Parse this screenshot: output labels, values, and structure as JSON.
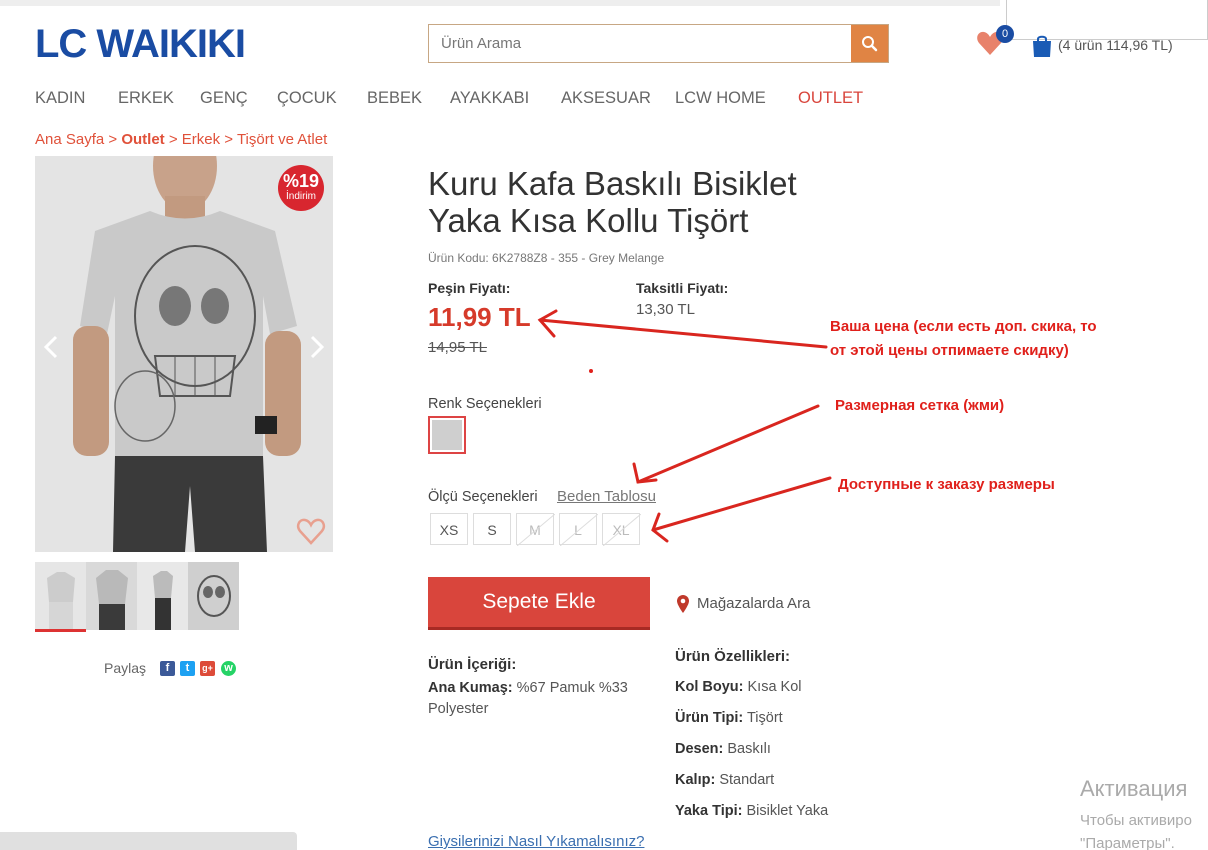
{
  "header": {
    "logo_text": "LC WAIKIKI",
    "search_placeholder": "Ürün Arama",
    "favorites_count": "0",
    "cart_summary": "(4 ürün 114,96 TL)"
  },
  "nav": {
    "items": [
      "KADIN",
      "ERKEK",
      "GENÇ",
      "ÇOCUK",
      "BEBEK",
      "AYAKKABI",
      "AKSESUAR",
      "LCW HOME",
      "OUTLET"
    ]
  },
  "breadcrumb": {
    "home": "Ana Sayfa",
    "sep": " > ",
    "outlet": "Outlet",
    "men": "Erkek",
    "category": "Tişört ve Atlet"
  },
  "product": {
    "discount_pct": "%19",
    "discount_label": "İndirim",
    "title": "Kuru Kafa Baskılı Bisiklet Yaka Kısa Kollu Tişört",
    "code": "Ürün Kodu: 6K2788Z8 - 355 - Grey Melange",
    "cash_price_label": "Peşin Fiyatı:",
    "cash_price": "11,99 TL",
    "old_price": "14,95 TL",
    "installment_label": "Taksitli Fiyatı:",
    "installment_price": "13,30 TL",
    "color_label": "Renk Seçenekleri",
    "size_label": "Ölçü Seçenekleri",
    "size_chart_link": "Beden Tablosu",
    "sizes": [
      "XS",
      "S",
      "M",
      "L",
      "XL"
    ],
    "add_to_cart": "Sepete Ekle",
    "store_search": "Mağazalarda Ara",
    "share_label": "Paylaş",
    "contents_label": "Ürün İçeriği:",
    "fabric_key": "Ana Kumaş:",
    "fabric_val_1": "%67 Pamuk %33",
    "fabric_val_2": "Polyester",
    "features_label": "Ürün Özellikleri:",
    "features": [
      {
        "k": "Kol Boyu:",
        "v": "Kısa Kol"
      },
      {
        "k": "Ürün Tipi:",
        "v": "Tişört"
      },
      {
        "k": "Desen:",
        "v": "Baskılı"
      },
      {
        "k": "Kalıp:",
        "v": "Standart"
      },
      {
        "k": "Yaka Tipi:",
        "v": "Bisiklet Yaka"
      }
    ],
    "wash_link": "Giysilerinizi Nasıl Yıkamalısınız?"
  },
  "annotations": {
    "price_note_1": "Ваша цена (если есть доп. скика, то",
    "price_note_2": "от этой цены отпимаете скидку)",
    "size_chart_note": "Размерная сетка (жми)",
    "sizes_note": "Доступные к заказу размеры"
  },
  "watermark": {
    "line1": "Активация",
    "line2": "Чтобы активиро",
    "line3": "\"Параметры\"."
  },
  "colors": {
    "brand": "#1a4ca3",
    "accent": "#d9453c",
    "search_button": "#e08444",
    "annotation": "#e0201b"
  }
}
